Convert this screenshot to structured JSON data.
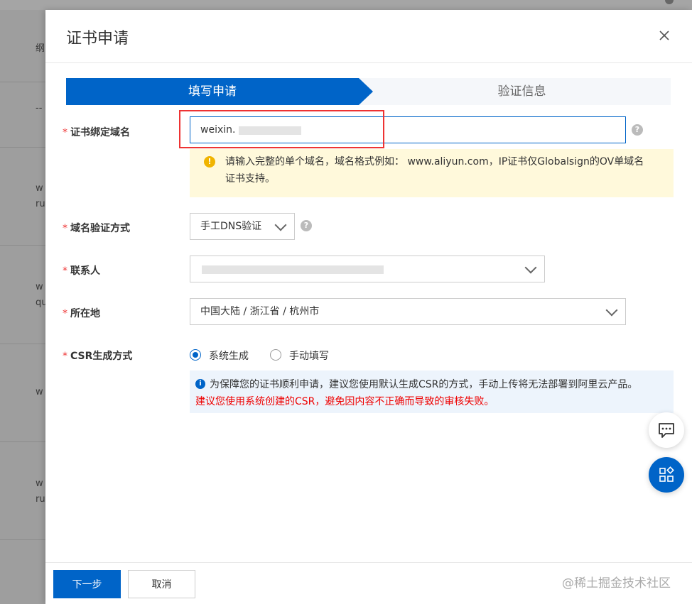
{
  "background": {
    "texts": [
      "纲",
      "--",
      "w",
      "ru",
      "w",
      "qu",
      "w",
      "w",
      "ru"
    ]
  },
  "dialog": {
    "title": "证书申请",
    "close_label": "×"
  },
  "steps": [
    {
      "label": "填写申请",
      "active": true
    },
    {
      "label": "验证信息",
      "active": false
    }
  ],
  "form": {
    "domain": {
      "label": "证书绑定域名",
      "value": "weixin.",
      "help": "?",
      "warning": "请输入完整的单个域名，域名格式例如： www.aliyun.com，IP证书仅Globalsign的OV单域名证书支持。"
    },
    "verify_method": {
      "label": "域名验证方式",
      "value": "手工DNS验证",
      "help": "?"
    },
    "contact": {
      "label": "联系人",
      "value": ""
    },
    "location": {
      "label": "所在地",
      "value": "中国大陆 / 浙江省 / 杭州市"
    },
    "csr": {
      "label": "CSR生成方式",
      "options": [
        {
          "label": "系统生成",
          "selected": true
        },
        {
          "label": "手动填写",
          "selected": false
        }
      ],
      "info": "为保障您的证书顺利申请，建议您使用默认生成CSR的方式，手动上传将无法部署到阿里云产品。",
      "warning_red": "建议您使用系统创建的CSR，避免因内容不正确而导致的审核失败。"
    },
    "required_mark": "*"
  },
  "footer": {
    "next_label": "下一步",
    "cancel_label": "取消",
    "watermark": "@稀土掘金技术社区"
  },
  "colors": {
    "primary": "#0064c8",
    "warning_bg": "#fff9db",
    "info_bg": "#edf4fc",
    "error": "#e00000"
  }
}
